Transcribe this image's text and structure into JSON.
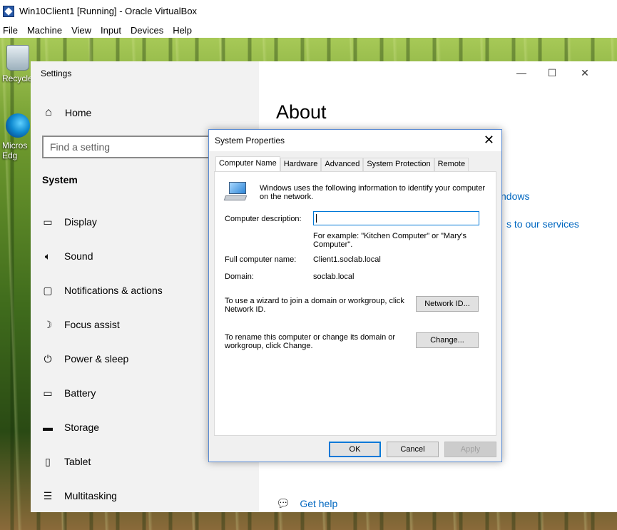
{
  "host": {
    "title": "Win10Client1 [Running] - Oracle VirtualBox",
    "menu": [
      "File",
      "Machine",
      "View",
      "Input",
      "Devices",
      "Help"
    ]
  },
  "desktop": {
    "icons": [
      {
        "label": "Recycle",
        "icon": "recycle-bin-icon"
      },
      {
        "label": "Micros Edg",
        "icon": "edge-icon"
      }
    ]
  },
  "settings": {
    "title": "Settings",
    "home": "Home",
    "search_placeholder": "Find a setting",
    "section": "System",
    "nav": [
      {
        "label": "Display",
        "icon": "display-icon"
      },
      {
        "label": "Sound",
        "icon": "sound-icon"
      },
      {
        "label": "Notifications & actions",
        "icon": "notifications-icon"
      },
      {
        "label": "Focus assist",
        "icon": "moon-icon"
      },
      {
        "label": "Power & sleep",
        "icon": "power-icon"
      },
      {
        "label": "Battery",
        "icon": "battery-icon"
      },
      {
        "label": "Storage",
        "icon": "storage-icon"
      },
      {
        "label": "Tablet",
        "icon": "tablet-icon"
      },
      {
        "label": "Multitasking",
        "icon": "multitasking-icon"
      }
    ],
    "page_title": "About",
    "links": [
      "ndows",
      "s to our services"
    ],
    "get_help": "Get help"
  },
  "dialog": {
    "title": "System Properties",
    "tabs": [
      "Computer Name",
      "Hardware",
      "Advanced",
      "System Protection",
      "Remote"
    ],
    "active_tab": "Computer Name",
    "intro": "Windows uses the following information to identify your computer on the network.",
    "description_label": "Computer description:",
    "description_value": "",
    "example": "For example: \"Kitchen Computer\" or \"Mary's Computer\".",
    "full_name_label": "Full computer name:",
    "full_name_value": "Client1.soclab.local",
    "domain_label": "Domain:",
    "domain_value": "soclab.local",
    "network_id_text": "To use a wizard to join a domain or workgroup, click Network ID.",
    "network_id_button": "Network ID...",
    "rename_text": "To rename this computer or change its domain or workgroup, click Change.",
    "change_button": "Change...",
    "ok_button": "OK",
    "cancel_button": "Cancel",
    "apply_button": "Apply"
  }
}
